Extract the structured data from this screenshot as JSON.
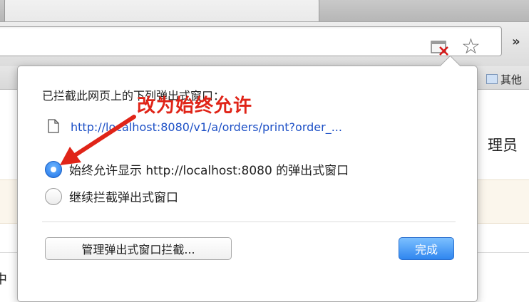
{
  "browser": {
    "icons": {
      "popup_blocked": "popup-blocked-icon",
      "bookmark_star": "star-icon",
      "overflow": "chevron-right-icon"
    },
    "star_glyph": "☆",
    "overflow_glyph": "»",
    "bookmarks_bar": {
      "other_bookmarks_label": "其他"
    }
  },
  "page_behind": {
    "right_cut_text": "理员",
    "left_cut_text": "中"
  },
  "popup_bubble": {
    "title": "已拦截此网页上的下列弹出式窗口：",
    "blocked_link": "http://localhost:8080/v1/a/orders/print?order_...",
    "options": [
      {
        "label": "始终允许显示 http://localhost:8080 的弹出式窗口",
        "selected": true
      },
      {
        "label": "继续拦截弹出式窗口",
        "selected": false
      }
    ],
    "manage_button": "管理弹出式窗口拦截...",
    "done_button": "完成"
  },
  "annotation": {
    "text": "改为始终允许",
    "color": "#e02418"
  },
  "colors": {
    "link": "#1d50c6",
    "primary_button": "#2f86ef",
    "radio_selected": "#1f73e8"
  }
}
